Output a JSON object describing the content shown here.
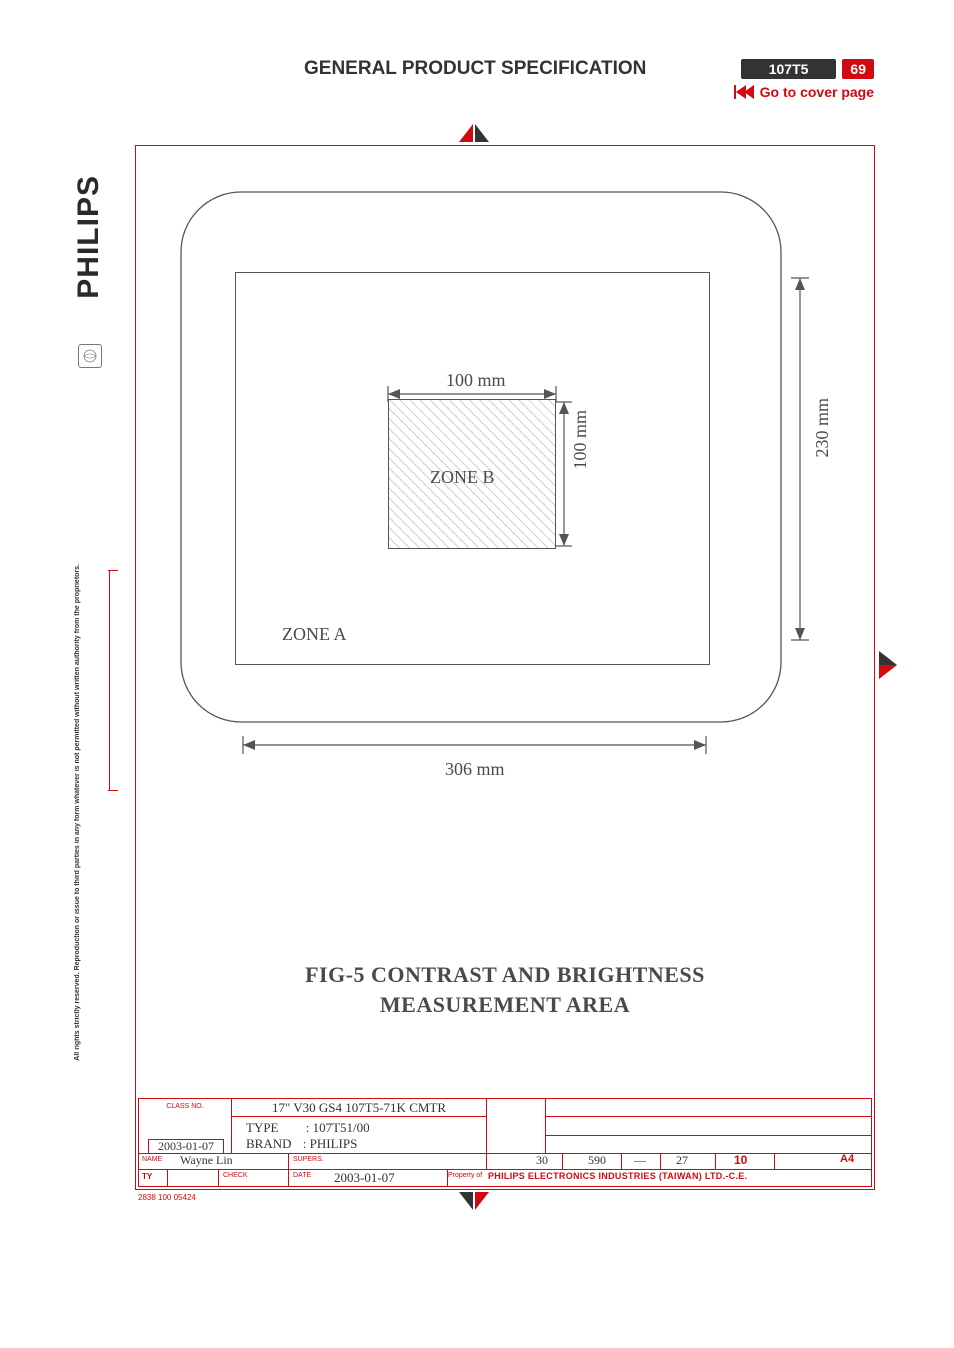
{
  "header": {
    "title": "GENERAL PRODUCT SPECIFICATION",
    "model": "107T5",
    "page": "69",
    "cover_link": "Go to cover page"
  },
  "sidebar": {
    "brand": "PHILIPS",
    "rights": "All rights strictly reserved. Reproduction or issue to third parties in any form whatever is not permitted without written authority from the proprietors."
  },
  "figure": {
    "zone_a": "ZONE   A",
    "zone_b": "ZONE   B",
    "dim_inner_w": "100  mm",
    "dim_inner_h": "100  mm",
    "dim_outer_w": "306  mm",
    "dim_outer_h": "230  mm",
    "caption_l1": "FIG-5  CONTRAST  AND  BRIGHTNESS",
    "caption_l2": "MEASUREMENT  AREA"
  },
  "titleblock": {
    "class_no_label": "CLASS NO.",
    "drawing_title": "17\" V30 GS4 107T5-71K CMTR",
    "type_label": "TYPE",
    "type_value": ": 107T51/00",
    "brand_label": "BRAND",
    "brand_value": ": PHILIPS",
    "date_top": "2003-01-07",
    "name_label": "NAME",
    "name_value": "Wayne Lin",
    "supers_label": "SUPERS.",
    "ty_label": "TY",
    "check_label": "CHECK",
    "date_label": "DATE",
    "date_bottom": "2003-01-07",
    "num_30": "30",
    "num_590": "590",
    "dash": "—",
    "num_27": "27",
    "num_10": "10",
    "size": "A4",
    "property_label": "Property of",
    "property_value": "PHILIPS   ELECTRONICS   INDUSTRIES   (TAIWAN)   LTD.-C.E.",
    "form_code": "2838   100   05424"
  }
}
